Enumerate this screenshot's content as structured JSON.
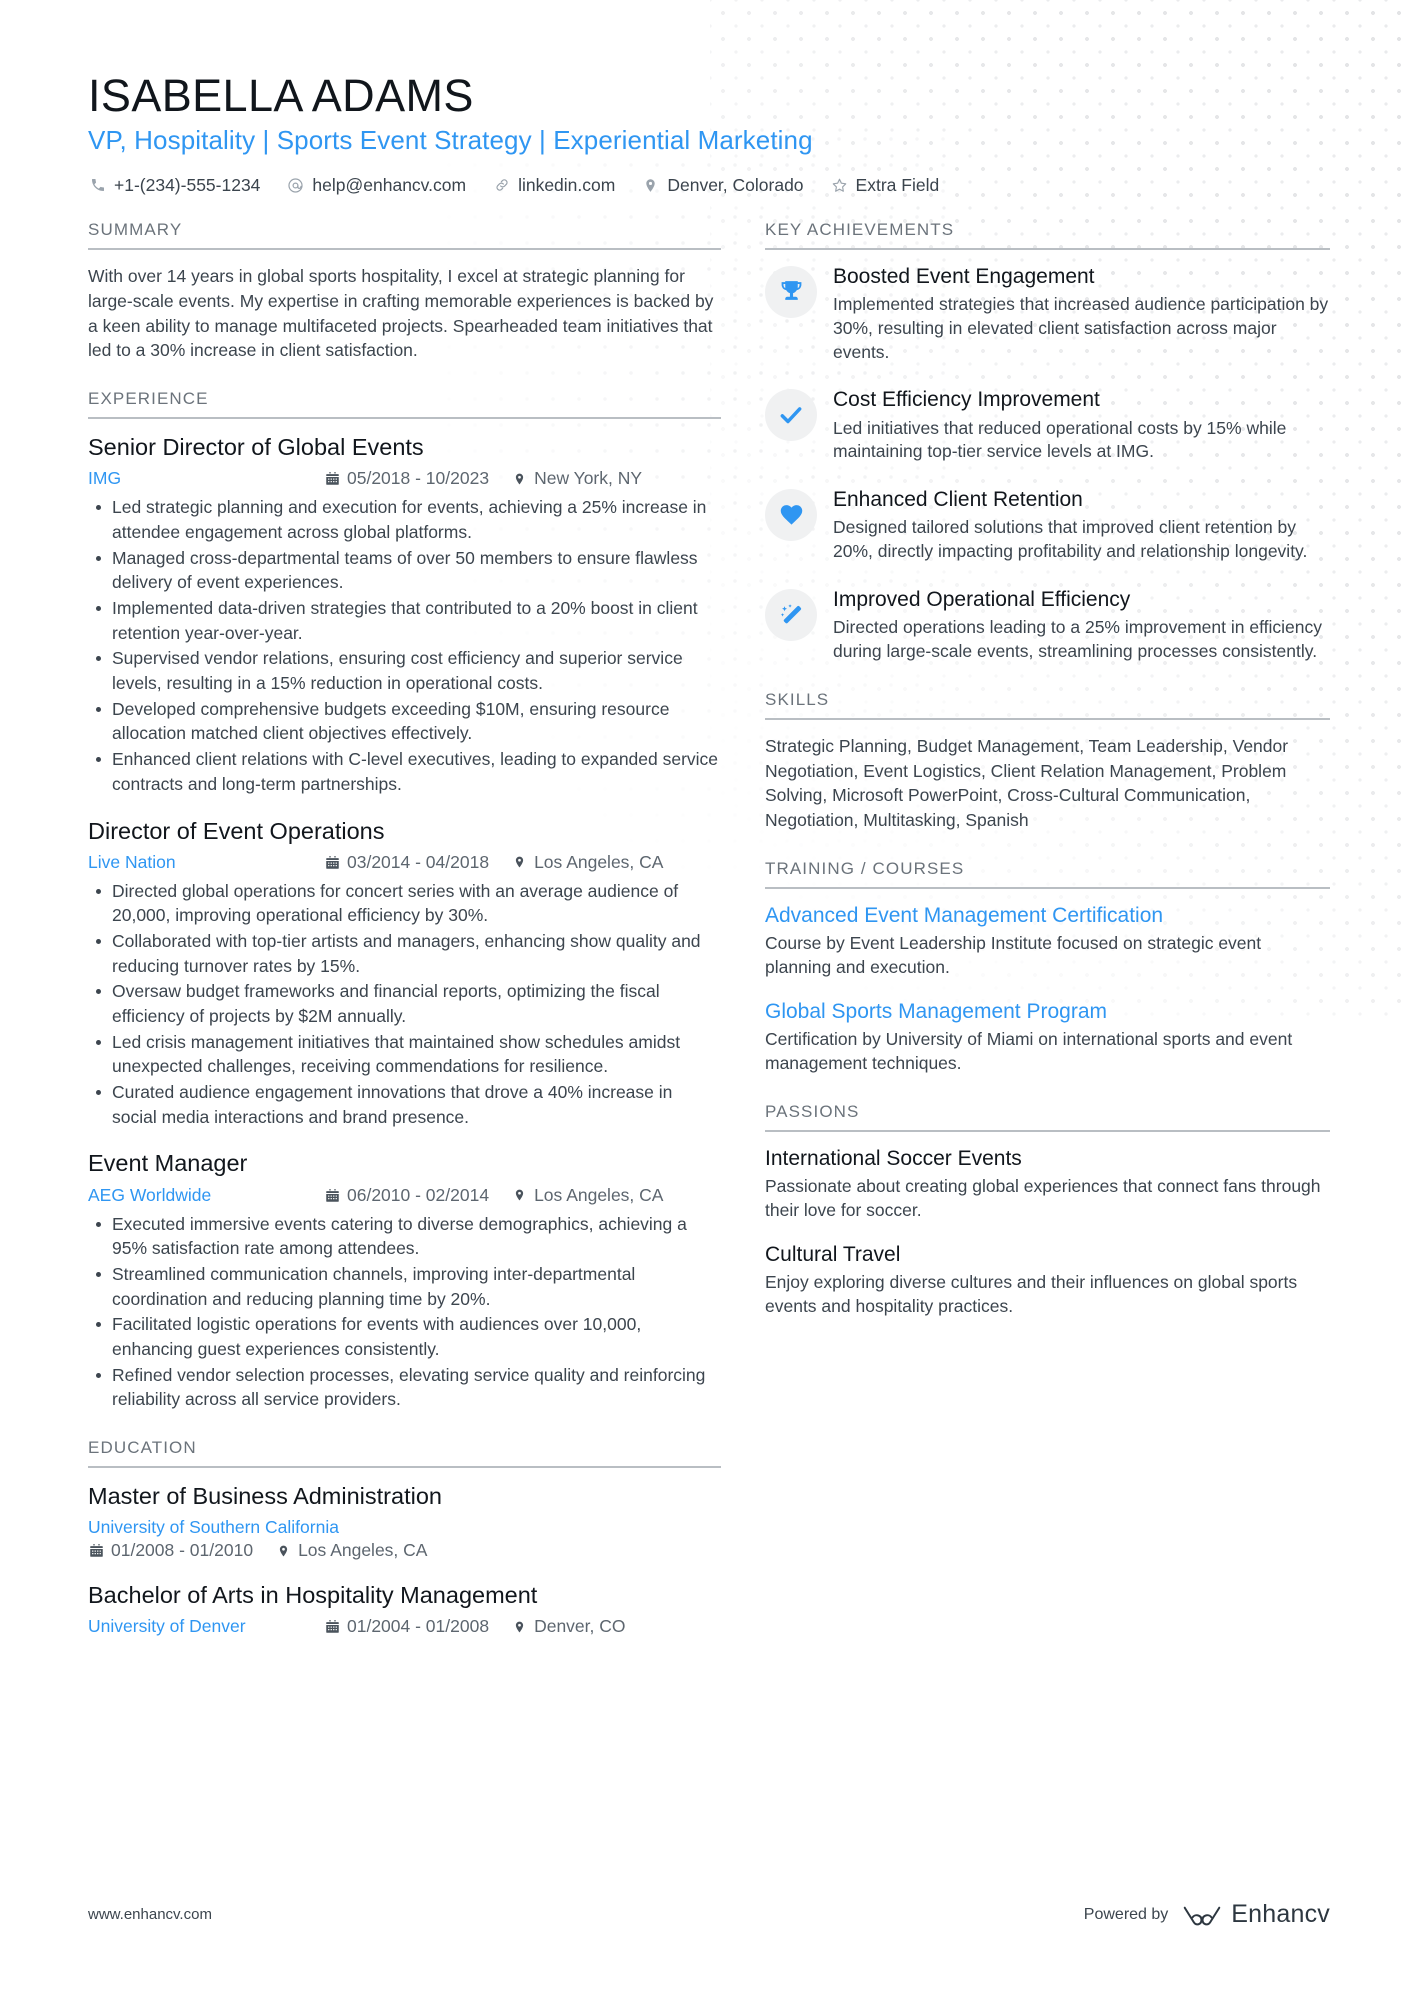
{
  "header": {
    "name": "ISABELLA ADAMS",
    "headline": "VP, Hospitality | Sports Event Strategy | Experiential Marketing",
    "contacts": [
      {
        "icon": "phone-icon",
        "value": "+1-(234)-555-1234"
      },
      {
        "icon": "email-icon",
        "value": "help@enhancv.com"
      },
      {
        "icon": "link-icon",
        "value": "linkedin.com"
      },
      {
        "icon": "location-pin-icon",
        "value": "Denver, Colorado"
      },
      {
        "icon": "star-icon",
        "value": "Extra Field"
      }
    ]
  },
  "colors": {
    "accent": "#2f96f2",
    "text": "#3c454e",
    "heading": "#11161c",
    "section_label": "#6b737b",
    "rule": "#b9bec3",
    "icon_bubble": "#f0f1f2"
  },
  "summary": {
    "label": "SUMMARY",
    "text": "With over 14 years in global sports hospitality, I excel at strategic planning for large-scale events. My expertise in crafting memorable experiences is backed by a keen ability to manage multifaceted projects. Spearheaded team initiatives that led to a 30% increase in client satisfaction."
  },
  "experience": {
    "label": "EXPERIENCE",
    "entries": [
      {
        "title": "Senior Director of Global Events",
        "org": "IMG",
        "dates": "05/2018 - 10/2023",
        "location": "New York, NY",
        "bullets": [
          "Led strategic planning and execution for events, achieving a 25% increase in attendee engagement across global platforms.",
          "Managed cross-departmental teams of over 50 members to ensure flawless delivery of event experiences.",
          "Implemented data-driven strategies that contributed to a 20% boost in client retention year-over-year.",
          "Supervised vendor relations, ensuring cost efficiency and superior service levels, resulting in a 15% reduction in operational costs.",
          "Developed comprehensive budgets exceeding $10M, ensuring resource allocation matched client objectives effectively.",
          "Enhanced client relations with C-level executives, leading to expanded service contracts and long-term partnerships."
        ]
      },
      {
        "title": "Director of Event Operations",
        "org": "Live Nation",
        "dates": "03/2014 - 04/2018",
        "location": "Los Angeles, CA",
        "bullets": [
          "Directed global operations for concert series with an average audience of 20,000, improving operational efficiency by 30%.",
          "Collaborated with top-tier artists and managers, enhancing show quality and reducing turnover rates by 15%.",
          "Oversaw budget frameworks and financial reports, optimizing the fiscal efficiency of projects by $2M annually.",
          "Led crisis management initiatives that maintained show schedules amidst unexpected challenges, receiving commendations for resilience.",
          "Curated audience engagement innovations that drove a 40% increase in social media interactions and brand presence."
        ]
      },
      {
        "title": "Event Manager",
        "org": "AEG Worldwide",
        "dates": "06/2010 - 02/2014",
        "location": "Los Angeles, CA",
        "bullets": [
          "Executed immersive events catering to diverse demographics, achieving a 95% satisfaction rate among attendees.",
          "Streamlined communication channels, improving inter-departmental coordination and reducing planning time by 20%.",
          "Facilitated logistic operations for events with audiences over 10,000, enhancing guest experiences consistently.",
          "Refined vendor selection processes, elevating service quality and reinforcing reliability across all service providers."
        ]
      }
    ]
  },
  "education": {
    "label": "EDUCATION",
    "entries": [
      {
        "title": "Master of Business Administration",
        "org": "University of Southern California",
        "dates": "01/2008 - 01/2010",
        "location": "Los Angeles, CA",
        "inline": false
      },
      {
        "title": "Bachelor of Arts in Hospitality Management",
        "org": "University of Denver",
        "dates": "01/2004 - 01/2008",
        "location": "Denver, CO",
        "inline": true
      }
    ]
  },
  "achievements": {
    "label": "KEY ACHIEVEMENTS",
    "items": [
      {
        "icon": "trophy-icon",
        "title": "Boosted Event Engagement",
        "desc": "Implemented strategies that increased audience participation by 30%, resulting in elevated client satisfaction across major events."
      },
      {
        "icon": "check-icon",
        "title": "Cost Efficiency Improvement",
        "desc": "Led initiatives that reduced operational costs by 15% while maintaining top-tier service levels at IMG."
      },
      {
        "icon": "heart-icon",
        "title": "Enhanced Client Retention",
        "desc": "Designed tailored solutions that improved client retention by 20%, directly impacting profitability and relationship longevity."
      },
      {
        "icon": "magic-wand-icon",
        "title": "Improved Operational Efficiency",
        "desc": "Directed operations leading to a 25% improvement in efficiency during large-scale events, streamlining processes consistently."
      }
    ]
  },
  "skills": {
    "label": "SKILLS",
    "text": "Strategic Planning, Budget Management, Team Leadership, Vendor Negotiation, Event Logistics, Client Relation Management, Problem Solving, Microsoft PowerPoint, Cross-Cultural Communication, Negotiation, Multitasking, Spanish"
  },
  "training": {
    "label": "TRAINING / COURSES",
    "items": [
      {
        "title": "Advanced Event Management Certification",
        "desc": "Course by Event Leadership Institute focused on strategic event planning and execution."
      },
      {
        "title": "Global Sports Management Program",
        "desc": "Certification by University of Miami on international sports and event management techniques."
      }
    ]
  },
  "passions": {
    "label": "PASSIONS",
    "items": [
      {
        "title": "International Soccer Events",
        "desc": "Passionate about creating global experiences that connect fans through their love for soccer."
      },
      {
        "title": "Cultural Travel",
        "desc": "Enjoy exploring diverse cultures and their influences on global sports events and hospitality practices."
      }
    ]
  },
  "footer": {
    "url": "www.enhancv.com",
    "powered_by": "Powered by",
    "brand": "Enhancv"
  }
}
